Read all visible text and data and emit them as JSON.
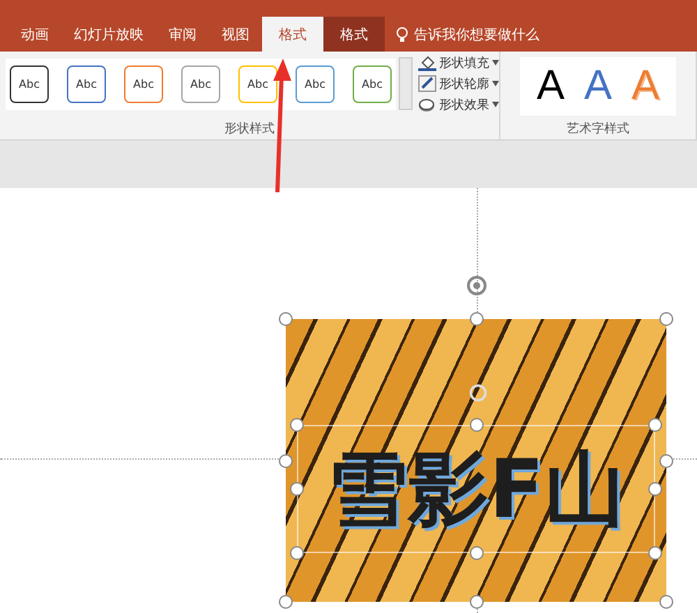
{
  "tabs": [
    {
      "label": "动画",
      "kind": "normal",
      "selected": false
    },
    {
      "label": "幻灯片放映",
      "kind": "normal",
      "selected": false
    },
    {
      "label": "审阅",
      "kind": "normal",
      "selected": false
    },
    {
      "label": "视图",
      "kind": "normal",
      "selected": false
    },
    {
      "label": "格式",
      "kind": "normal",
      "selected": true
    },
    {
      "label": "格式",
      "kind": "contextual",
      "selected": false
    }
  ],
  "tell_me": "告诉我你想要做什么",
  "shape_styles": [
    {
      "label": "Abc",
      "color": "#333333"
    },
    {
      "label": "Abc",
      "color": "#4472c4"
    },
    {
      "label": "Abc",
      "color": "#ed7d31"
    },
    {
      "label": "Abc",
      "color": "#a5a5a5"
    },
    {
      "label": "Abc",
      "color": "#ffc000"
    },
    {
      "label": "Abc",
      "color": "#5b9bd5"
    },
    {
      "label": "Abc",
      "color": "#70ad47"
    }
  ],
  "shape_commands": [
    {
      "label": "形状填充",
      "kind": "fill"
    },
    {
      "label": "形状轮廓",
      "kind": "outline"
    },
    {
      "label": "形状效果",
      "kind": "effect"
    }
  ],
  "groups": [
    "形状样式",
    "艺术字样式"
  ],
  "wordart_styles": [
    {
      "label": "A",
      "kind": "solid",
      "color": "#000000"
    },
    {
      "label": "A",
      "kind": "solid",
      "color": "#4472c4"
    },
    {
      "label": "A",
      "kind": "outline",
      "color": "#ed7d31"
    }
  ],
  "slide_text": "雪影F山"
}
